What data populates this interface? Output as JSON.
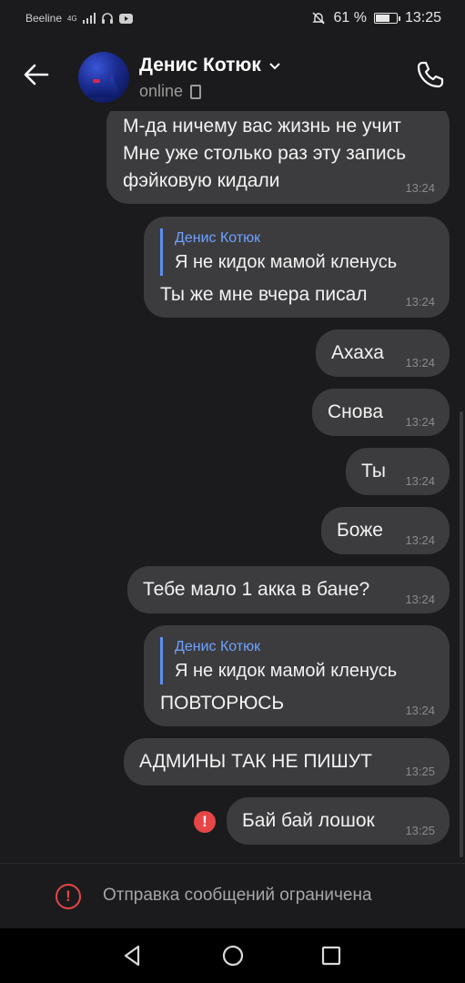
{
  "status_bar": {
    "carrier": "Beeline",
    "network": "4G",
    "battery": "61 %",
    "battery_level": 0.61,
    "time": "13:25"
  },
  "header": {
    "contact_name": "Денис Котюк",
    "status": "online"
  },
  "messages": [
    {
      "lines": [
        "М-да ничему вас жизнь не учит",
        "Мне уже столько раз эту запись",
        "фэйковую кидали"
      ],
      "time": "13:24"
    },
    {
      "reply": {
        "author": "Денис Котюк",
        "text": "Я не кидок мамой кленусь"
      },
      "text": "Ты же мне вчера писал",
      "time": "13:24"
    },
    {
      "text": "Ахаха",
      "time": "13:24"
    },
    {
      "text": "Снова",
      "time": "13:24"
    },
    {
      "text": "Ты",
      "time": "13:24"
    },
    {
      "text": "Боже",
      "time": "13:24"
    },
    {
      "text": "Тебе мало 1 акка в бане?",
      "time": "13:24"
    },
    {
      "reply": {
        "author": "Денис Котюк",
        "text": "Я не кидок мамой кленусь"
      },
      "text": "ПОВТОРЮСЬ",
      "time": "13:24"
    },
    {
      "text": "АДМИНЫ ТАК НЕ ПИШУТ",
      "time": "13:25"
    },
    {
      "text": "Бай бай лошок",
      "time": "13:25",
      "error_icon": "!"
    }
  ],
  "restriction": {
    "icon": "!",
    "text": "Отправка сообщений ограничена"
  },
  "colors": {
    "bubble": "#3c3c3e",
    "background": "#1b1b1d",
    "accent": "#5b8ff0",
    "error": "#e64646"
  },
  "icons": [
    "back-arrow-icon",
    "chevron-down-icon",
    "phone-icon",
    "call-icon",
    "error-icon",
    "nav-back-icon",
    "nav-home-icon",
    "nav-recents-icon"
  ]
}
